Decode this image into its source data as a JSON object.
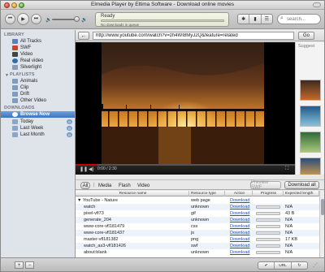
{
  "window": {
    "title": "Elmedia Player by Eltima Software - Download online movies"
  },
  "toolbar": {
    "prev_icon": "⏮",
    "play_icon": "▶",
    "next_icon": "⏭",
    "vol_low_icon": "🔈",
    "vol_high_icon": "🔊",
    "lcd_status": "Ready",
    "lcd_sub": "No downloads in queue",
    "view_buttons": [
      "✱",
      "▮",
      "☰"
    ],
    "search_placeholder": "search..."
  },
  "sidebar": {
    "library_header": "LIBRARY",
    "library": [
      {
        "label": "All Tracks",
        "icon": "music-icon",
        "color": "#5b7fb8"
      },
      {
        "label": "SWF",
        "icon": "flash-icon",
        "color": "#c9462b"
      },
      {
        "label": "Video",
        "icon": "film-icon",
        "color": "#444444"
      },
      {
        "label": "Real video",
        "icon": "real-video-icon",
        "color": "#2d6ea8"
      },
      {
        "label": "Silverlight",
        "icon": "silverlight-icon",
        "color": "#8a9bb3"
      }
    ],
    "playlists_header": "PLAYLISTS",
    "playlists": [
      {
        "label": "Animals",
        "icon": "playlist-icon",
        "color": "#7d9bc4"
      },
      {
        "label": "Clip",
        "icon": "playlist-icon",
        "color": "#7d9bc4"
      },
      {
        "label": "Drift",
        "icon": "playlist-icon",
        "color": "#7d9bc4"
      },
      {
        "label": "Other Video",
        "icon": "playlist-icon",
        "color": "#7d9bc4"
      }
    ],
    "downloads_header": "DOWNLOADS",
    "downloads": [
      {
        "label": "Browse Now",
        "icon": "globe-icon",
        "color": "#ffffff",
        "selected": true
      },
      {
        "label": "Today",
        "icon": "folder-icon",
        "color": "#8aa6cc",
        "badge": "0"
      },
      {
        "label": "Last Week",
        "icon": "folder-icon",
        "color": "#8aa6cc",
        "badge": "0"
      },
      {
        "label": "Last Month",
        "icon": "folder-icon",
        "color": "#8aa6cc",
        "badge": "0"
      }
    ]
  },
  "browser": {
    "back_icon": "←",
    "url": "http://www.youtube.com/watch?v=zh4WI8MyJ2Q&feature=related",
    "go_label": "Go",
    "suggest_label": "Suggest"
  },
  "player": {
    "time": "0:00 / 2:30",
    "play_icon": "❚❚",
    "fullscreen_icon": "⛶",
    "progress": 0.1
  },
  "tabs": {
    "all": "All",
    "items": [
      "Media",
      "Flash",
      "Video"
    ],
    "preview_label": "Preview SWF",
    "download_all_label": "Download all"
  },
  "table": {
    "headers": [
      "Resource name",
      "Resource type",
      "Action",
      "Progress",
      "Expected length"
    ],
    "group": {
      "name": "YouTube - Nature",
      "type": "web page",
      "action": "Download",
      "length": ""
    },
    "rows": [
      {
        "name": "watch",
        "type": "unknown",
        "action": "Download",
        "length": "N/A"
      },
      {
        "name": "pixel-vfl73",
        "type": "gif",
        "action": "Download",
        "length": "43 B"
      },
      {
        "name": "generate_204",
        "type": "unknown",
        "action": "Download",
        "length": "N/A"
      },
      {
        "name": "www-core-vfl181479",
        "type": "css",
        "action": "Download",
        "length": "N/A"
      },
      {
        "name": "www-core-vfl181437",
        "type": "js",
        "action": "Download",
        "length": "N/A"
      },
      {
        "name": "master-vfl181382",
        "type": "png",
        "action": "Download",
        "length": "17 KB"
      },
      {
        "name": "watch_as3-vfl181426",
        "type": "swf",
        "action": "Download",
        "length": "N/A"
      },
      {
        "name": "about:blank",
        "type": "unknown",
        "action": "Download",
        "length": "N/A"
      }
    ]
  },
  "bottombar": {
    "add_icon": "+",
    "remove_icon": "−",
    "mode_buttons": [
      "✔",
      "URL",
      "↻"
    ],
    "grip_icon": "⋰"
  }
}
